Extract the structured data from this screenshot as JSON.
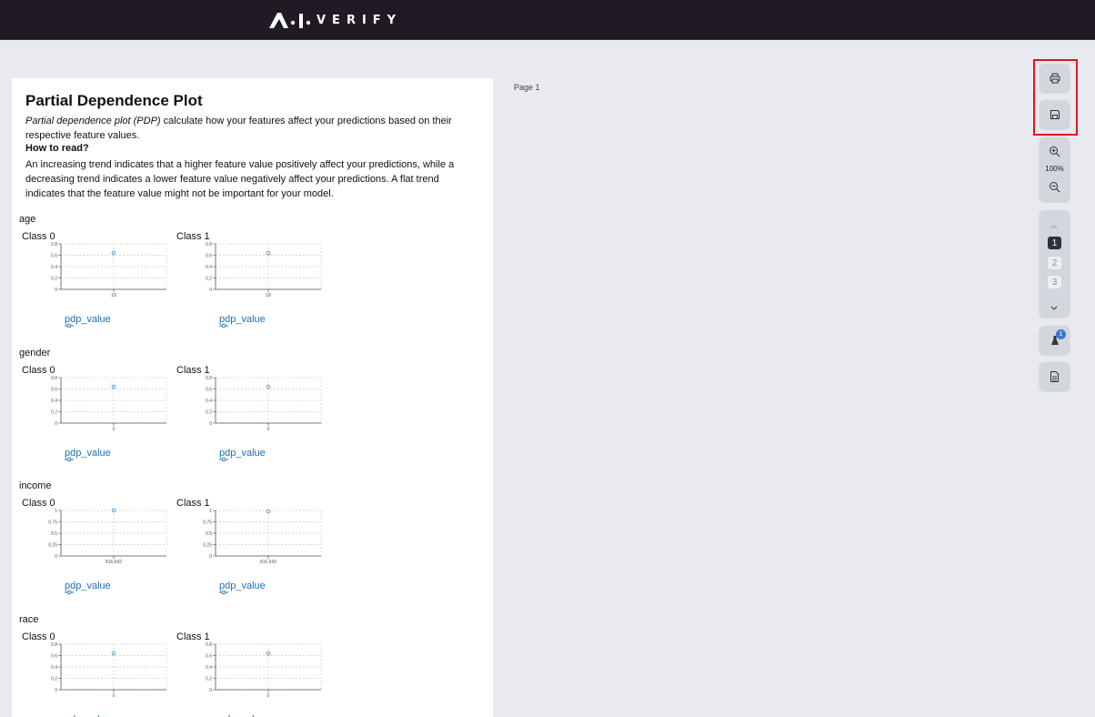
{
  "app": {
    "logo_text": "VERIFY"
  },
  "page_label": "Page 1",
  "report": {
    "title": "Partial Dependence Plot",
    "desc_em": "Partial dependence plot (PDP)",
    "desc_rest": " calculate how your features affect your predictions based on their respective feature values.",
    "how_title": "How to read?",
    "how_text": "An increasing trend indicates that a higher feature value positively affect your predictions, while a decreasing trend indicates a lower feature value negatively affect your predictions. A flat trend indicates that the feature value might not be important for your model.",
    "features": [
      {
        "name": "age",
        "x_tick": "18",
        "classes": [
          {
            "label": "Class 0",
            "legend": "pdp_value"
          },
          {
            "label": "Class 1",
            "legend": "pdp_value"
          }
        ]
      },
      {
        "name": "gender",
        "x_tick": "0",
        "classes": [
          {
            "label": "Class 0",
            "legend": "pdp_value"
          },
          {
            "label": "Class 1",
            "legend": "pdp_value"
          }
        ]
      },
      {
        "name": "income",
        "x_tick": "816.642",
        "classes": [
          {
            "label": "Class 0",
            "legend": "pdp_value"
          },
          {
            "label": "Class 1",
            "legend": "pdp_value"
          }
        ]
      },
      {
        "name": "race",
        "x_tick": "0",
        "classes": [
          {
            "label": "Class 0",
            "legend": "pdp_value"
          },
          {
            "label": "Class 1",
            "legend": "pdp_value"
          }
        ]
      }
    ]
  },
  "chart_data": [
    {
      "type": "scatter",
      "title": "Class 0",
      "feature": "age",
      "x": [
        "18"
      ],
      "y": [
        0.64
      ],
      "ylim": [
        0,
        0.8
      ],
      "yticks": [
        "0",
        "0.2",
        "0.4",
        "0.6",
        "0.8"
      ],
      "series": [
        {
          "name": "pdp_value",
          "values": [
            0.64
          ]
        }
      ]
    },
    {
      "type": "scatter",
      "title": "Class 1",
      "feature": "age",
      "x": [
        "18"
      ],
      "y": [
        0.64
      ],
      "ylim": [
        0,
        0.8
      ],
      "yticks": [
        "0",
        "0.2",
        "0.4",
        "0.6",
        "0.8"
      ],
      "series": [
        {
          "name": "pdp_value",
          "values": [
            0.64
          ]
        }
      ]
    },
    {
      "type": "scatter",
      "title": "Class 0",
      "feature": "gender",
      "x": [
        "0"
      ],
      "y": [
        0.64
      ],
      "ylim": [
        0,
        0.8
      ],
      "yticks": [
        "0",
        "0.2",
        "0.4",
        "0.6",
        "0.8"
      ],
      "series": [
        {
          "name": "pdp_value",
          "values": [
            0.64
          ]
        }
      ]
    },
    {
      "type": "scatter",
      "title": "Class 1",
      "feature": "gender",
      "x": [
        "0"
      ],
      "y": [
        0.64
      ],
      "ylim": [
        0,
        0.8
      ],
      "yticks": [
        "0",
        "0.2",
        "0.4",
        "0.6",
        "0.8"
      ],
      "series": [
        {
          "name": "pdp_value",
          "values": [
            0.64
          ]
        }
      ]
    },
    {
      "type": "scatter",
      "title": "Class 0",
      "feature": "income",
      "x": [
        "816.642"
      ],
      "y": [
        1.0
      ],
      "ylim": [
        0,
        1
      ],
      "yticks": [
        "0",
        "0.25",
        "0.5",
        "0.75",
        "1"
      ],
      "series": [
        {
          "name": "pdp_value",
          "values": [
            1.0
          ]
        }
      ]
    },
    {
      "type": "scatter",
      "title": "Class 1",
      "feature": "income",
      "x": [
        "816.642"
      ],
      "y": [
        0.98
      ],
      "ylim": [
        0,
        1
      ],
      "yticks": [
        "0",
        "0.25",
        "0.5",
        "0.75",
        "1"
      ],
      "series": [
        {
          "name": "pdp_value",
          "values": [
            0.98
          ]
        }
      ]
    },
    {
      "type": "scatter",
      "title": "Class 0",
      "feature": "race",
      "x": [
        "0"
      ],
      "y": [
        0.64
      ],
      "ylim": [
        0,
        0.8
      ],
      "yticks": [
        "0",
        "0.2",
        "0.4",
        "0.6",
        "0.8"
      ],
      "series": [
        {
          "name": "pdp_value",
          "values": [
            0.64
          ]
        }
      ]
    },
    {
      "type": "scatter",
      "title": "Class 1",
      "feature": "race",
      "x": [
        "0"
      ],
      "y": [
        0.64
      ],
      "ylim": [
        0,
        0.8
      ],
      "yticks": [
        "0",
        "0.2",
        "0.4",
        "0.6",
        "0.8"
      ],
      "series": [
        {
          "name": "pdp_value",
          "values": [
            0.64
          ]
        }
      ]
    }
  ],
  "toolbar": {
    "zoom": "100%",
    "pages": [
      "1",
      "2",
      "3"
    ],
    "active_page": "1",
    "plugin_badge": "1",
    "icons": [
      "printer-icon",
      "save-icon",
      "zoom-in-icon",
      "zoom-out-icon",
      "chevron-up-icon",
      "chevron-down-icon",
      "flask-icon",
      "document-icon"
    ]
  },
  "colors": {
    "topbar": "#211a24",
    "point": "#4a90c8",
    "legend": "#1f6fb2",
    "highlight": "#e0141c",
    "active_page": "#2c3142"
  }
}
